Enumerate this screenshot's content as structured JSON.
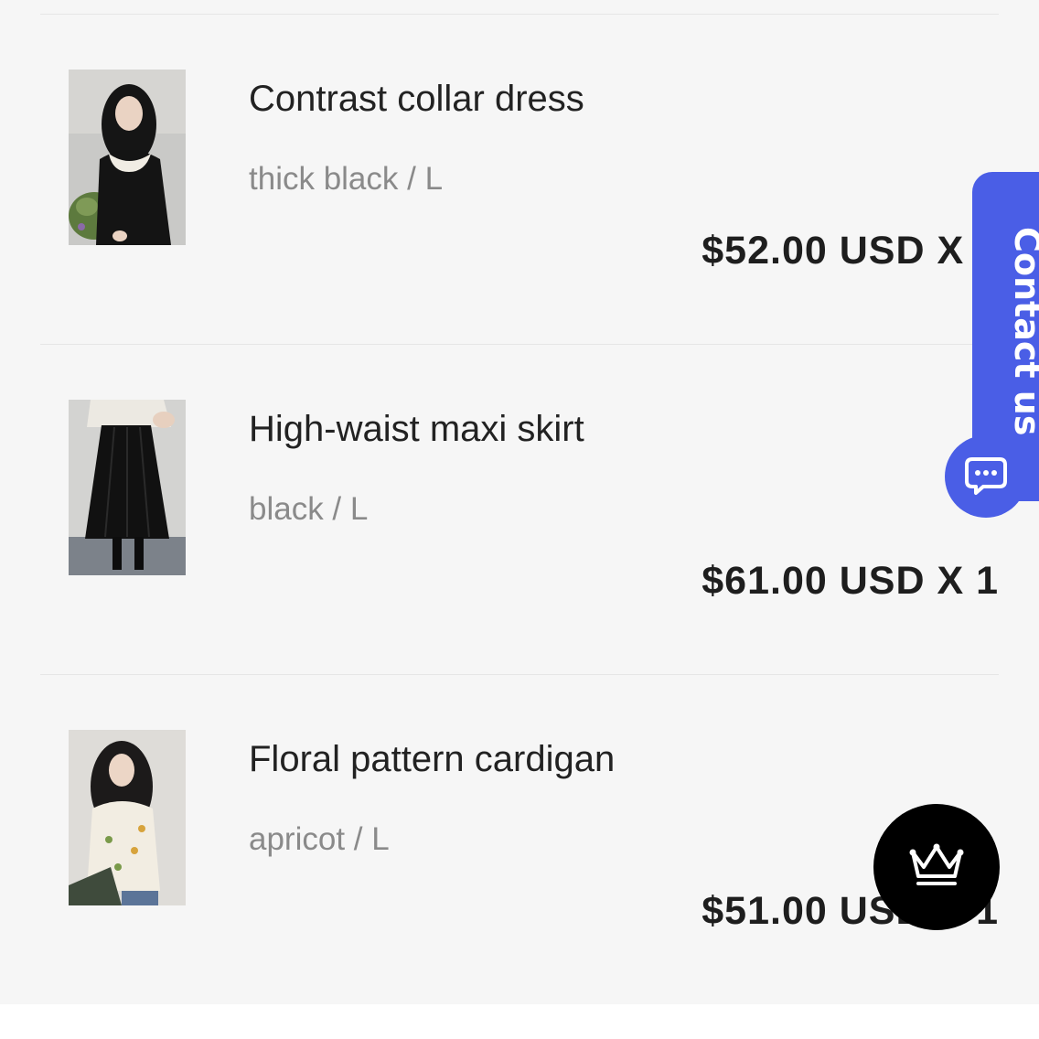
{
  "cart": {
    "items": [
      {
        "title": "Contrast collar dress",
        "variant": "thick black / L",
        "price": "$52.00 USD X 1",
        "thumbnail_icon": "dress-photo"
      },
      {
        "title": "High-waist maxi skirt",
        "variant": "black / L",
        "price": "$61.00 USD X 1",
        "thumbnail_icon": "skirt-photo"
      },
      {
        "title": "Floral pattern cardigan",
        "variant": "apricot / L",
        "price": "$51.00 USD X 1",
        "thumbnail_icon": "cardigan-photo"
      }
    ]
  },
  "widgets": {
    "contact_label": "Contact us",
    "chat_icon": "chat-bubble-icon",
    "crown_icon": "crown-icon",
    "accent_color": "#4a5ee6"
  }
}
